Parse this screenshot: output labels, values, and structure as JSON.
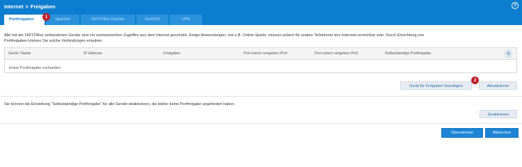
{
  "header": {
    "breadcrumb": [
      "Internet",
      "Freigaben"
    ],
    "separator": ">",
    "help_icon": "?"
  },
  "tabs": [
    {
      "label": "Portfreigaben",
      "active": true
    },
    {
      "label": "Speicher",
      "active": false
    },
    {
      "label": "FRITZ!Box-Dienste",
      "active": false
    },
    {
      "label": "DynDNS",
      "active": false
    },
    {
      "label": "VPN",
      "active": false
    }
  ],
  "badges": {
    "one": "1",
    "two": "2"
  },
  "intro": {
    "line1": "Alle mit der FRITZ!Box verbundenen Geräte sind vor unerwünschten Zugriffen aus dem Internet geschützt. Einige Anwendungen, wie z.B. Online-Spiele, müssen jedoch für andere Teilnehmer des Internets erreichbar sein. Durch Einrichtung von",
    "line2": "Portfreigaben können Sie solche Verbindungen erlauben."
  },
  "table": {
    "columns": [
      "Gerät / Name",
      "IP-Adresse",
      "Freigaben",
      "Port extern vergeben IPv4",
      "Port extern vergeben IPv6",
      "Selbstständige Portfreigabe"
    ],
    "sort_icon": "⇅",
    "empty_text": "Keine Portfreigabe vorhanden"
  },
  "buttons": {
    "add_device": "Gerät für Freigaben hinzufügen",
    "refresh": "Aktualisieren",
    "deactivate": "Deaktivieren",
    "apply": "Übernehmen",
    "cancel": "Abbrechen"
  },
  "info_text": "Sie können die Einstellung \"Selbstständige Portfreigabe\" für alle Geräte deaktivieren, die bisher keine Portfreigabe angefordert haben.",
  "colors": {
    "header": "#0d7ecf",
    "tab_inactive": "#2a92dd",
    "badge": "#c0202a",
    "primary_button": "#1b85d6"
  }
}
